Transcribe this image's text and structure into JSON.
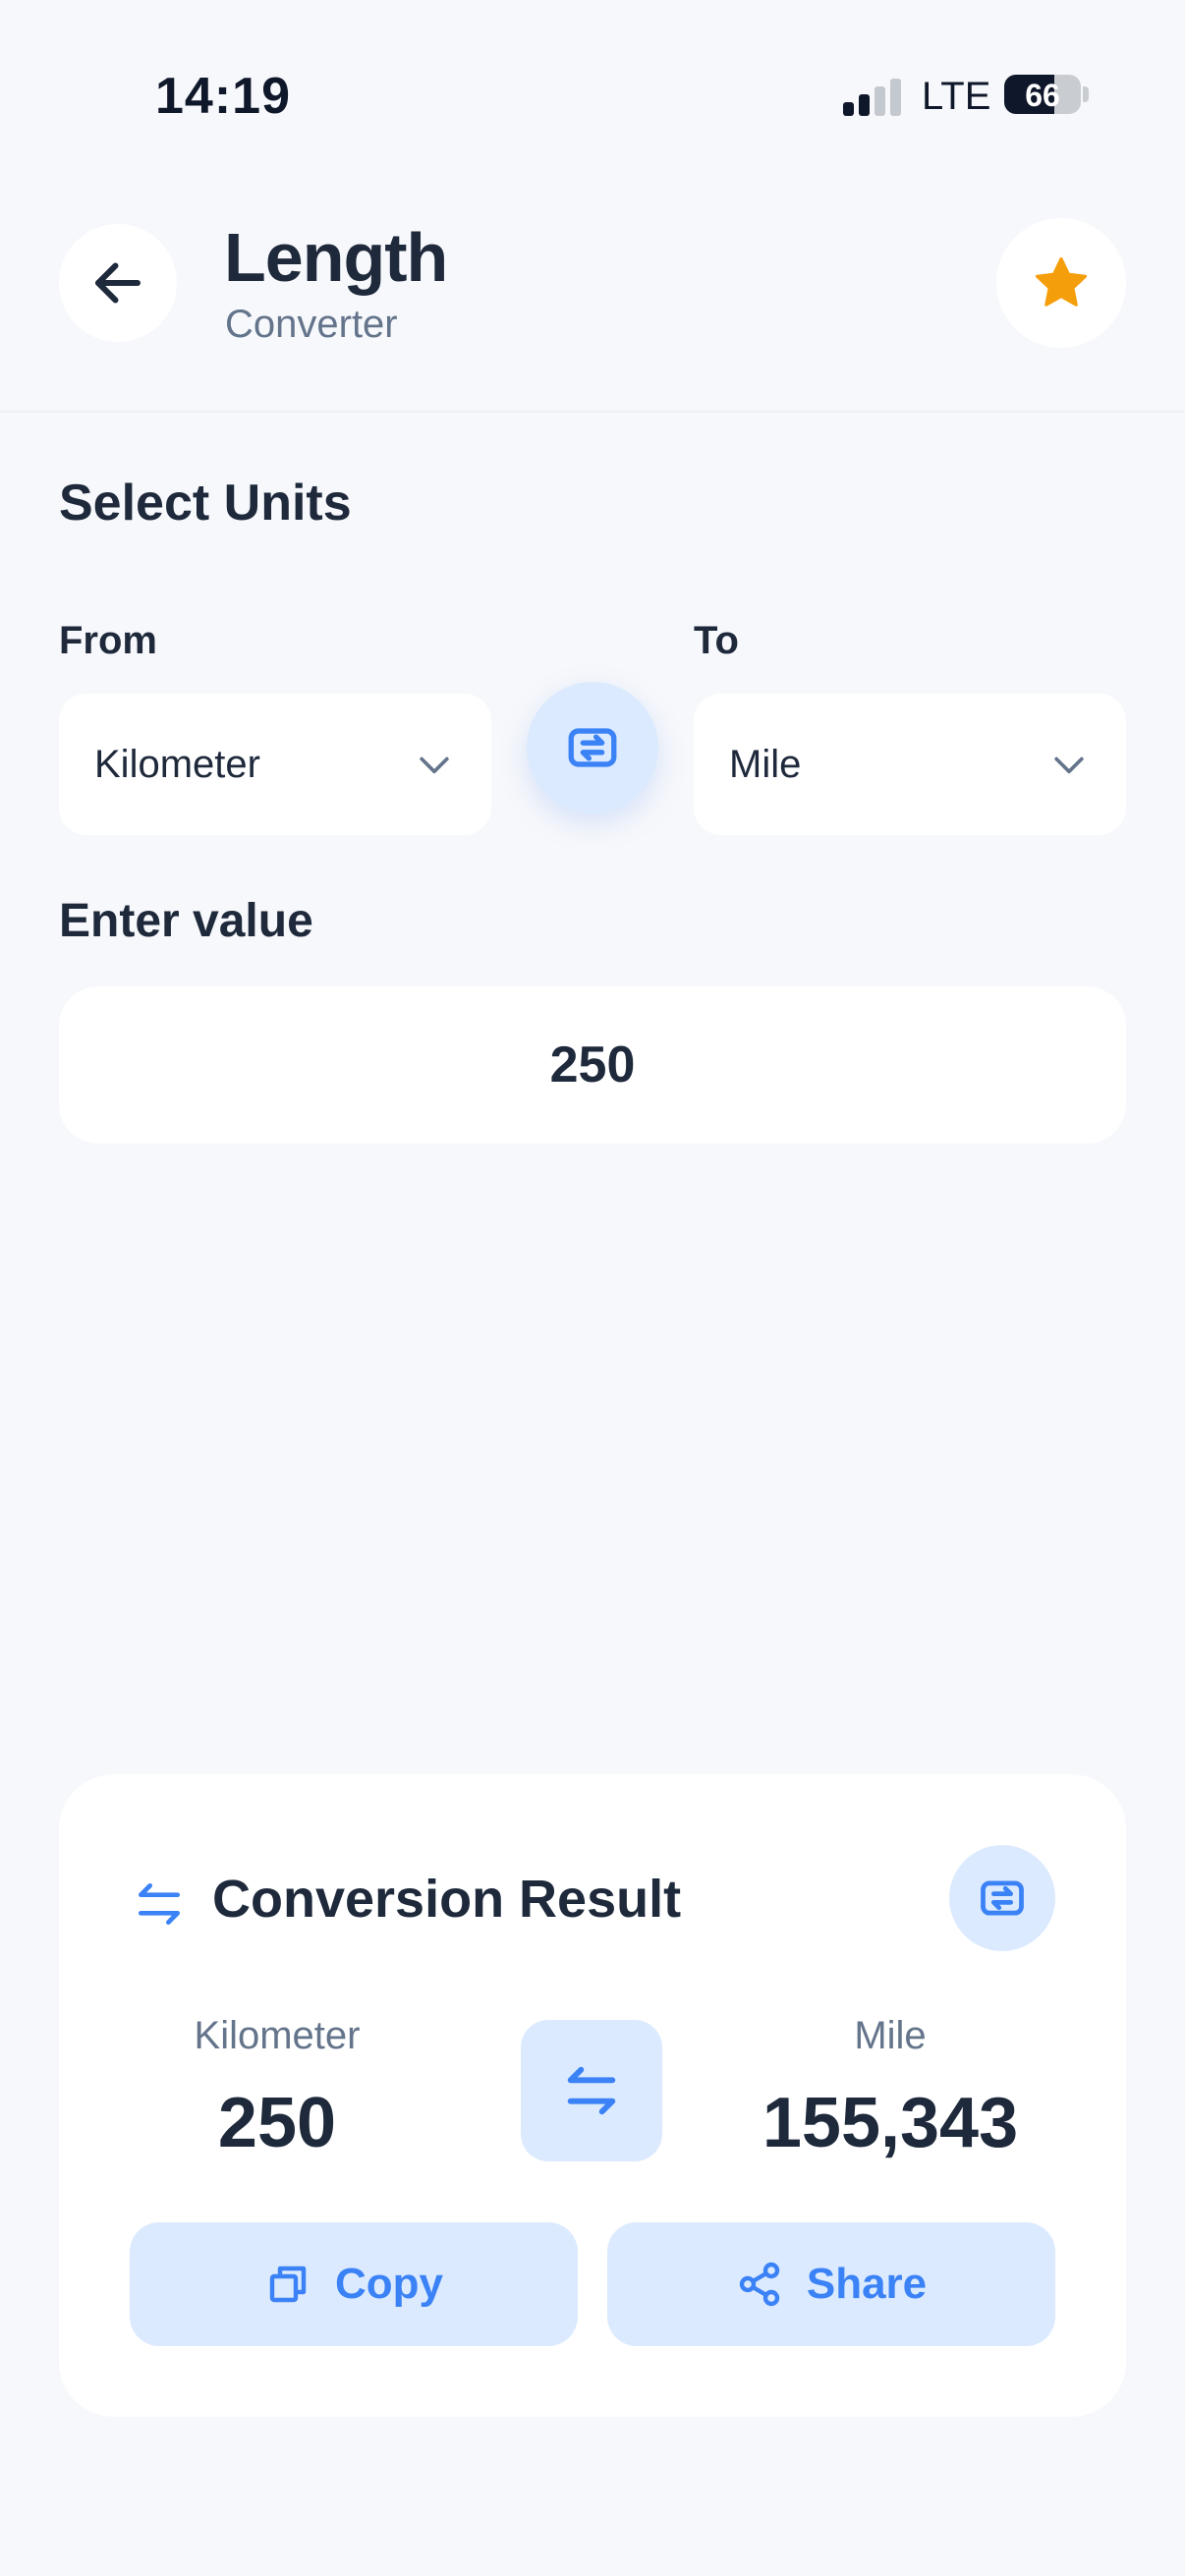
{
  "status_bar": {
    "time": "14:19",
    "network": "LTE",
    "battery": "66",
    "battery_level": 0.66
  },
  "header": {
    "title": "Length",
    "subtitle": "Converter"
  },
  "units": {
    "section_title": "Select Units",
    "from_label": "From",
    "to_label": "To",
    "from_unit": "Kilometer",
    "to_unit": "Mile"
  },
  "input": {
    "label": "Enter value",
    "value": "250"
  },
  "result": {
    "title": "Conversion Result",
    "from_unit": "Kilometer",
    "from_value": "250",
    "to_unit": "Mile",
    "to_value": "155,343",
    "copy_label": "Copy",
    "share_label": "Share"
  },
  "colors": {
    "accent": "#3b82f6",
    "accent_soft": "#dbeafe",
    "star": "#f59e0b",
    "text": "#1e293b",
    "muted": "#64748b",
    "background": "#f7f8fb"
  },
  "icons": [
    "back-arrow-icon",
    "star-icon",
    "chevron-down-icon",
    "swap-icon",
    "arrows-left-right-icon",
    "copy-icon",
    "share-icon"
  ]
}
